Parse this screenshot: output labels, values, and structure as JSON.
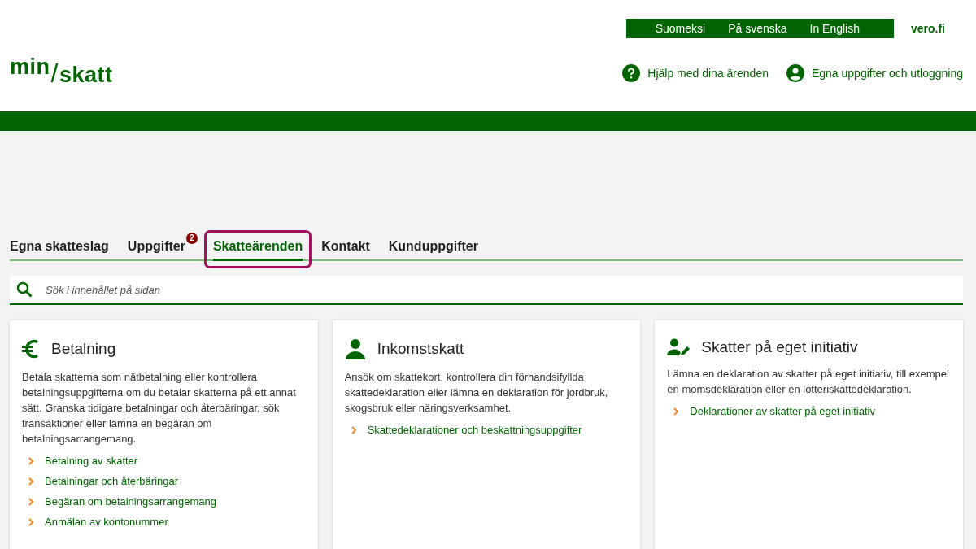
{
  "header": {
    "logo": [
      "min",
      "/",
      "skatt"
    ],
    "languages": [
      "Suomeksi",
      "På svenska",
      "In English"
    ],
    "site_link": "vero.fi",
    "help_link": "Hjälp med dina ärenden",
    "account_link": "Egna uppgifter och utloggning"
  },
  "tabs": [
    {
      "label": "Egna skatteslag",
      "selected": false,
      "highlighted": false
    },
    {
      "label": "Uppgifter",
      "selected": false,
      "highlighted": false,
      "badge": "2"
    },
    {
      "label": "Skatteärenden",
      "selected": true,
      "highlighted": true
    },
    {
      "label": "Kontakt",
      "selected": false,
      "highlighted": false
    },
    {
      "label": "Kunduppgifter",
      "selected": false,
      "highlighted": false
    }
  ],
  "search": {
    "placeholder": "Sök i innehållet på sidan"
  },
  "cards": [
    {
      "kind": "euro",
      "title": "Betalning",
      "text": "Betala skatterna som nätbetalning eller kontrollera betalningsuppgifterna om du betalar skatterna på ett annat sätt. Granska tidigare betalningar och återbäringar, sök transaktioner eller lämna en begäran om betalningsarrangemang.",
      "links": [
        "Betalning av skatter",
        "Betalningar och återbäringar",
        "Begäran om betalningsarrangemang",
        "Anmälan av kontonummer"
      ]
    },
    {
      "kind": "person",
      "title": "Inkomstskatt",
      "text": "Ansök om skattekort, kontrollera din förhandsifyllda skattedeklaration eller lämna en deklaration för jordbruk, skogsbruk eller näringsverksamhet.",
      "links": [
        "Skattedeklarationer och beskattningsuppgifter"
      ]
    },
    {
      "kind": "person-edit",
      "title": "Skatter på eget initiativ",
      "text": "Lämna en deklaration av skatter på eget initiativ, till exempel en momsdeklaration eller en lotteriskattedeklaration.",
      "links": [
        "Deklarationer av skatter på eget initiativ"
      ]
    }
  ]
}
